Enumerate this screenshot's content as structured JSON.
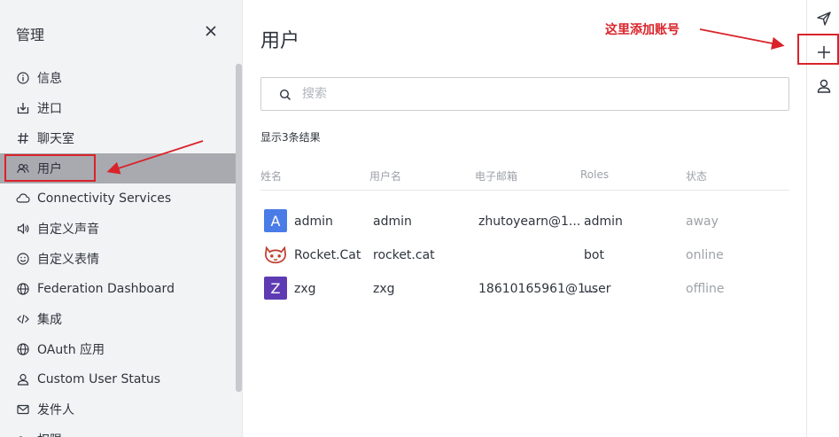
{
  "sidebar": {
    "title": "管理",
    "items": [
      {
        "label": "信息",
        "icon": "info-icon"
      },
      {
        "label": "进口",
        "icon": "import-icon"
      },
      {
        "label": "聊天室",
        "icon": "hashtag-icon"
      },
      {
        "label": "用户",
        "icon": "users-icon",
        "active": true
      },
      {
        "label": "Connectivity Services",
        "icon": "cloud-icon"
      },
      {
        "label": "自定义声音",
        "icon": "sound-icon"
      },
      {
        "label": "自定义表情",
        "icon": "emoji-icon"
      },
      {
        "label": "Federation Dashboard",
        "icon": "globe-icon"
      },
      {
        "label": "集成",
        "icon": "code-icon"
      },
      {
        "label": "OAuth 应用",
        "icon": "globe-icon"
      },
      {
        "label": "Custom User Status",
        "icon": "user-icon"
      },
      {
        "label": "发件人",
        "icon": "mail-icon"
      },
      {
        "label": "权限",
        "icon": "key-icon"
      }
    ]
  },
  "main": {
    "title": "用户",
    "search_placeholder": "搜索",
    "result_count": "显示3条结果",
    "columns": [
      "姓名",
      "用户名",
      "电子邮箱",
      "Roles",
      "状态"
    ],
    "rows": [
      {
        "avatar_letter": "A",
        "avatar_color": "#4a7ce8",
        "name": "admin",
        "username": "admin",
        "email": "zhutoyearn@1...",
        "role": "admin",
        "status": "away"
      },
      {
        "avatar_letter": "",
        "avatar_color": "#ffffff",
        "name": "Rocket.Cat",
        "username": "rocket.cat",
        "email": "",
        "role": "bot",
        "status": "online"
      },
      {
        "avatar_letter": "Z",
        "avatar_color": "#5e3bb3",
        "name": "zxg",
        "username": "zxg",
        "email": "18610165961@1...",
        "role": "user",
        "status": "offline"
      }
    ]
  },
  "rail": {
    "buttons": [
      "send-icon",
      "plus-icon",
      "user-icon"
    ]
  },
  "annotation": {
    "note": "这里添加账号",
    "color": "#d9232a"
  }
}
